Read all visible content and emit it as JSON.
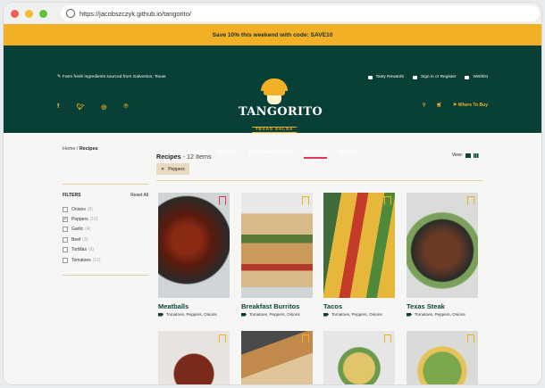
{
  "browser": {
    "url": "https://jacobszczyk.github.io/tangorito/"
  },
  "promo": {
    "text": "Save 10% this weekend with code: SAVE10"
  },
  "header": {
    "tagline": "Farm fresh ingredients sourced from Galveston, Texas",
    "utility": [
      "Tasty Rewards",
      "Sign in or Register",
      "Wishlist"
    ],
    "social": [
      "f",
      "t",
      "ig",
      "p"
    ],
    "where_to_buy": "Where To Buy",
    "logo_name": "TANGORITO",
    "logo_sub": "TEXAS SALSA"
  },
  "nav": [
    {
      "label": "SALSA",
      "active": false
    },
    {
      "label": "QUESO",
      "active": false
    },
    {
      "label": "TORTILLA CHIPS",
      "active": false
    },
    {
      "label": "RECIPES",
      "active": true
    },
    {
      "label": "ABOUT",
      "active": false
    }
  ],
  "breadcrumb": {
    "home": "Home",
    "current": "Recipes"
  },
  "filters": {
    "title": "FILTERS",
    "reset": "Reset All",
    "items": [
      {
        "label": "Onions",
        "count": "(8)",
        "checked": false
      },
      {
        "label": "Peppers",
        "count": "(10)",
        "checked": true
      },
      {
        "label": "Garlic",
        "count": "(4)",
        "checked": false
      },
      {
        "label": "Beef",
        "count": "(3)",
        "checked": false
      },
      {
        "label": "Tortillas",
        "count": "(6)",
        "checked": false
      },
      {
        "label": "Tomatoes",
        "count": "(12)",
        "checked": false
      }
    ]
  },
  "listing": {
    "title": "Recipes",
    "count": "- 12 Items",
    "view_label": "View:",
    "active_chip": "Peppers"
  },
  "recipes": [
    {
      "title": "Meatballs",
      "tags": "Tomatoes, Peppers, Onions"
    },
    {
      "title": "Breakfast Burritos",
      "tags": "Tomatoes, Peppers, Onions"
    },
    {
      "title": "Tacos",
      "tags": "Tomatoes, Peppers, Onions"
    },
    {
      "title": "Texas Steak",
      "tags": "Tomatoes, Peppers, Onions"
    }
  ],
  "colors": {
    "brand_green": "#083f36",
    "accent": "#f2b027",
    "nav_active": "#e0345a"
  }
}
